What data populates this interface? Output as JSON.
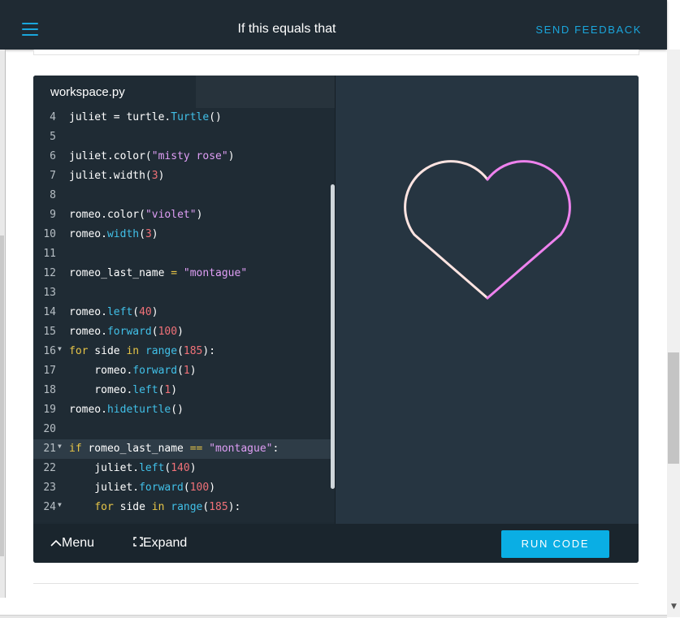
{
  "header": {
    "title": "If this equals that",
    "feedback_label": "SEND FEEDBACK"
  },
  "editor": {
    "tab_label": "workspace.py",
    "lines": [
      {
        "n": "4",
        "fold": false,
        "highlight": false,
        "tokens": [
          [
            "v",
            "juliet "
          ],
          [
            "p",
            "= "
          ],
          [
            "v",
            "turtle."
          ],
          [
            "fn",
            "Turtle"
          ],
          [
            "p",
            "()"
          ]
        ]
      },
      {
        "n": "5",
        "fold": false,
        "highlight": false,
        "tokens": []
      },
      {
        "n": "6",
        "fold": false,
        "highlight": false,
        "tokens": [
          [
            "v",
            "juliet."
          ],
          [
            "p",
            "color("
          ],
          [
            "str",
            "\"misty rose\""
          ],
          [
            "p",
            ")"
          ]
        ]
      },
      {
        "n": "7",
        "fold": false,
        "highlight": false,
        "tokens": [
          [
            "v",
            "juliet."
          ],
          [
            "p",
            "width("
          ],
          [
            "num",
            "3"
          ],
          [
            "p",
            ")"
          ]
        ]
      },
      {
        "n": "8",
        "fold": false,
        "highlight": false,
        "tokens": []
      },
      {
        "n": "9",
        "fold": false,
        "highlight": false,
        "tokens": [
          [
            "v",
            "romeo."
          ],
          [
            "p",
            "color("
          ],
          [
            "str",
            "\"violet\""
          ],
          [
            "p",
            ")"
          ]
        ]
      },
      {
        "n": "10",
        "fold": false,
        "highlight": false,
        "tokens": [
          [
            "v",
            "romeo."
          ],
          [
            "fn",
            "width"
          ],
          [
            "p",
            "("
          ],
          [
            "num",
            "3"
          ],
          [
            "p",
            ")"
          ]
        ]
      },
      {
        "n": "11",
        "fold": false,
        "highlight": false,
        "tokens": []
      },
      {
        "n": "12",
        "fold": false,
        "highlight": false,
        "tokens": [
          [
            "v",
            "romeo_last_name "
          ],
          [
            "op",
            "="
          ],
          [
            "v",
            " "
          ],
          [
            "str",
            "\"montague\""
          ]
        ]
      },
      {
        "n": "13",
        "fold": false,
        "highlight": false,
        "tokens": []
      },
      {
        "n": "14",
        "fold": false,
        "highlight": false,
        "tokens": [
          [
            "v",
            "romeo."
          ],
          [
            "fn",
            "left"
          ],
          [
            "p",
            "("
          ],
          [
            "num",
            "40"
          ],
          [
            "p",
            ")"
          ]
        ]
      },
      {
        "n": "15",
        "fold": false,
        "highlight": false,
        "tokens": [
          [
            "v",
            "romeo."
          ],
          [
            "fn",
            "forward"
          ],
          [
            "p",
            "("
          ],
          [
            "num",
            "100"
          ],
          [
            "p",
            ")"
          ]
        ]
      },
      {
        "n": "16",
        "fold": true,
        "highlight": false,
        "tokens": [
          [
            "kw",
            "for"
          ],
          [
            "v",
            " side "
          ],
          [
            "kw",
            "in"
          ],
          [
            "v",
            " "
          ],
          [
            "fn",
            "range"
          ],
          [
            "p",
            "("
          ],
          [
            "num",
            "185"
          ],
          [
            "p",
            "):"
          ]
        ]
      },
      {
        "n": "17",
        "fold": false,
        "highlight": false,
        "tokens": [
          [
            "v",
            "    romeo."
          ],
          [
            "fn",
            "forward"
          ],
          [
            "p",
            "("
          ],
          [
            "num",
            "1"
          ],
          [
            "p",
            ")"
          ]
        ]
      },
      {
        "n": "18",
        "fold": false,
        "highlight": false,
        "tokens": [
          [
            "v",
            "    romeo."
          ],
          [
            "fn",
            "left"
          ],
          [
            "p",
            "("
          ],
          [
            "num",
            "1"
          ],
          [
            "p",
            ")"
          ]
        ]
      },
      {
        "n": "19",
        "fold": false,
        "highlight": false,
        "tokens": [
          [
            "v",
            "romeo."
          ],
          [
            "fn",
            "hideturtle"
          ],
          [
            "p",
            "()"
          ]
        ]
      },
      {
        "n": "20",
        "fold": false,
        "highlight": false,
        "tokens": []
      },
      {
        "n": "21",
        "fold": true,
        "highlight": true,
        "tokens": [
          [
            "kw",
            "if"
          ],
          [
            "v",
            " romeo_last_name "
          ],
          [
            "op",
            "=="
          ],
          [
            "v",
            " "
          ],
          [
            "str",
            "\"montague\""
          ],
          [
            "p",
            ":"
          ]
        ]
      },
      {
        "n": "22",
        "fold": false,
        "highlight": false,
        "tokens": [
          [
            "v",
            "    juliet."
          ],
          [
            "fn",
            "left"
          ],
          [
            "p",
            "("
          ],
          [
            "num",
            "140"
          ],
          [
            "p",
            ")"
          ]
        ]
      },
      {
        "n": "23",
        "fold": false,
        "highlight": false,
        "tokens": [
          [
            "v",
            "    juliet."
          ],
          [
            "fn",
            "forward"
          ],
          [
            "p",
            "("
          ],
          [
            "num",
            "100"
          ],
          [
            "p",
            ")"
          ]
        ]
      },
      {
        "n": "24",
        "fold": true,
        "highlight": false,
        "tokens": [
          [
            "v",
            "    "
          ],
          [
            "kw",
            "for"
          ],
          [
            "v",
            " side "
          ],
          [
            "kw",
            "in"
          ],
          [
            "v",
            " "
          ],
          [
            "fn",
            "range"
          ],
          [
            "p",
            "("
          ],
          [
            "num",
            "185"
          ],
          [
            "p",
            "):"
          ]
        ]
      }
    ]
  },
  "canvas": {
    "left_stroke_color": "#ffe4e1",
    "right_stroke_color": "#ee82ee"
  },
  "footer": {
    "menu_label": "Menu",
    "expand_label": "Expand",
    "run_label": "RUN CODE"
  },
  "icons": {
    "menu": "hamburger-icon",
    "menu_toggle": "chevron-up-icon",
    "expand": "expand-icon"
  }
}
